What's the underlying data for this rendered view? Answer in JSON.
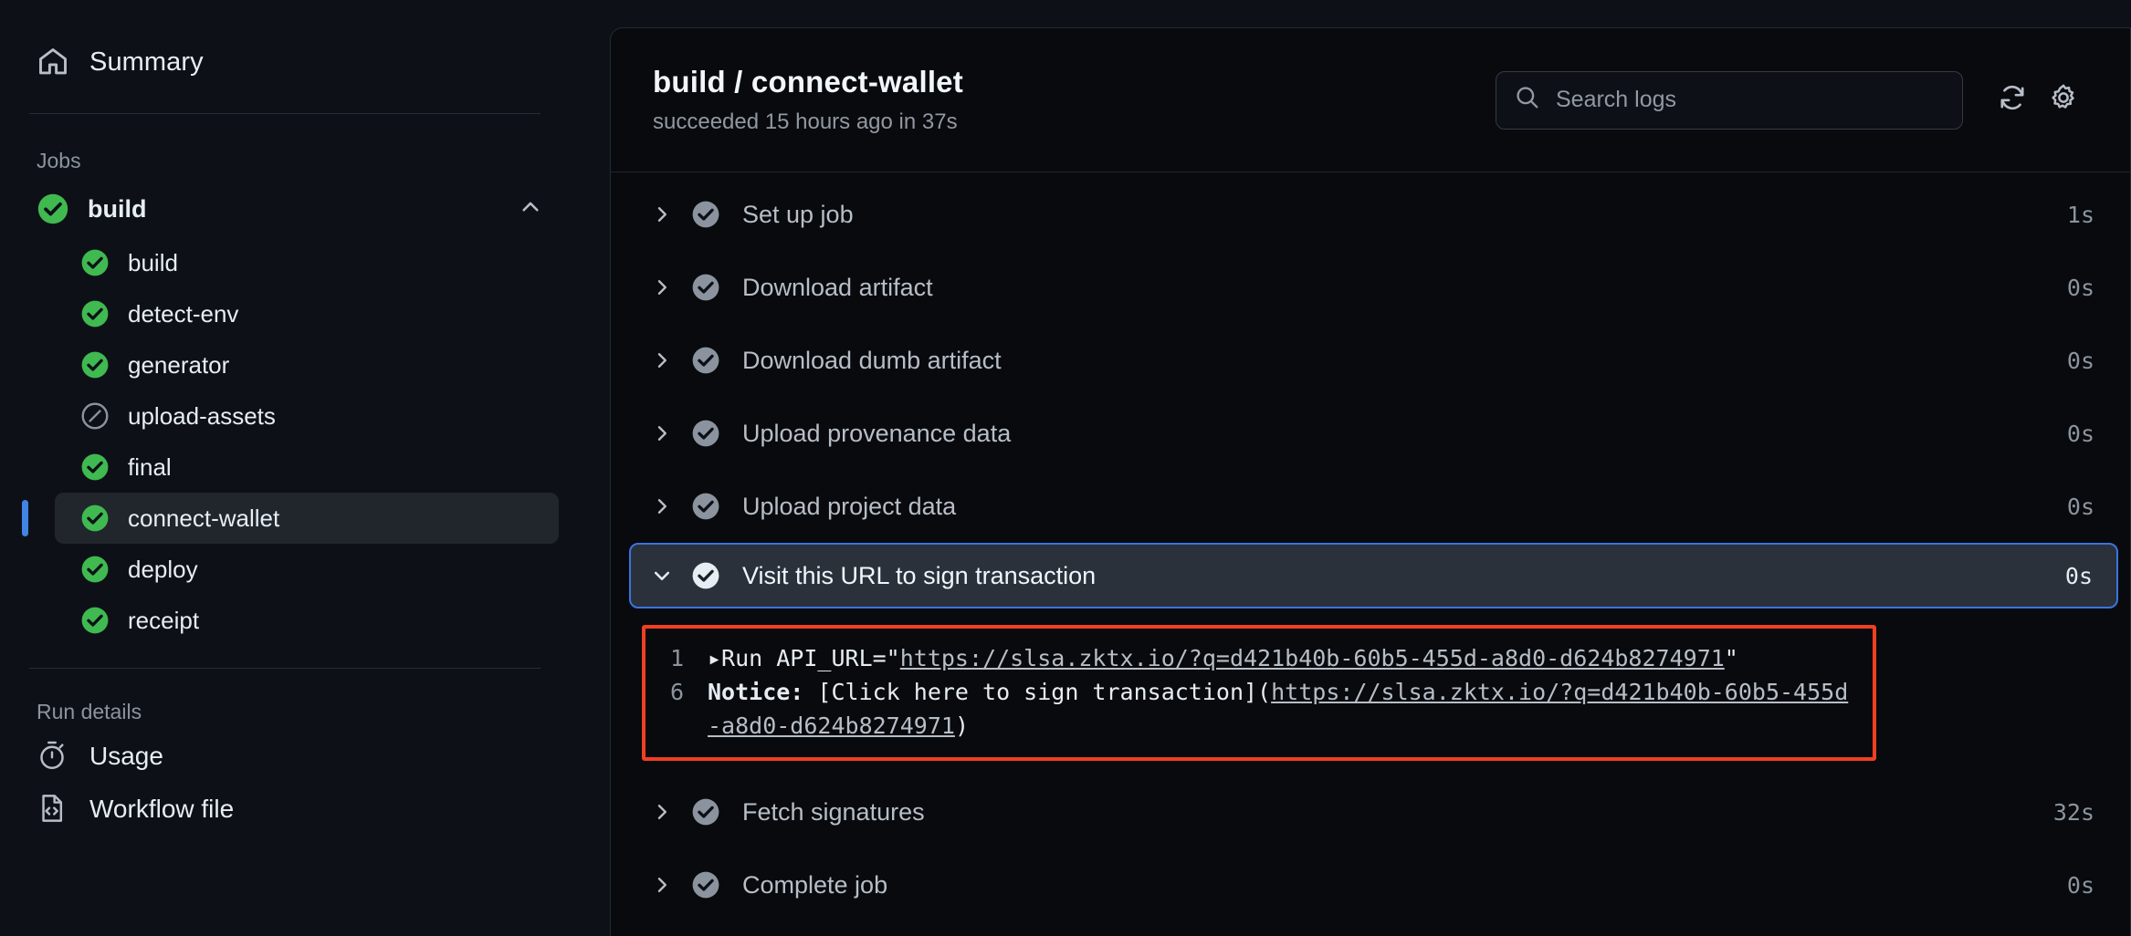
{
  "sidebar": {
    "summary": {
      "label": "Summary",
      "icon": "home-icon"
    },
    "jobs_label": "Jobs",
    "job": {
      "label": "build",
      "status": "success",
      "expanded": true
    },
    "steps": [
      {
        "label": "build",
        "status": "success"
      },
      {
        "label": "detect-env",
        "status": "success"
      },
      {
        "label": "generator",
        "status": "success"
      },
      {
        "label": "upload-assets",
        "status": "skipped"
      },
      {
        "label": "final",
        "status": "success"
      },
      {
        "label": "connect-wallet",
        "status": "success",
        "selected": true
      },
      {
        "label": "deploy",
        "status": "success"
      },
      {
        "label": "receipt",
        "status": "success"
      }
    ],
    "run_details_label": "Run details",
    "run_details": [
      {
        "label": "Usage",
        "icon": "stopwatch-icon"
      },
      {
        "label": "Workflow file",
        "icon": "workflow-file-icon"
      }
    ]
  },
  "header": {
    "title": "build / connect-wallet",
    "subtitle": "succeeded 15 hours ago in 37s",
    "search_placeholder": "Search logs",
    "search_value": "",
    "refresh_icon": "refresh-icon",
    "settings_icon": "gear-icon"
  },
  "log_steps": [
    {
      "title": "Set up job",
      "duration": "1s",
      "expanded": false,
      "status": "success"
    },
    {
      "title": "Download artifact",
      "duration": "0s",
      "expanded": false,
      "status": "success"
    },
    {
      "title": "Download dumb artifact",
      "duration": "0s",
      "expanded": false,
      "status": "success"
    },
    {
      "title": "Upload provenance data",
      "duration": "0s",
      "expanded": false,
      "status": "success"
    },
    {
      "title": "Upload project data",
      "duration": "0s",
      "expanded": false,
      "status": "success"
    },
    {
      "title": "Visit this URL to sign transaction",
      "duration": "0s",
      "expanded": true,
      "status": "success",
      "selected": true
    },
    {
      "title": "Fetch signatures",
      "duration": "32s",
      "expanded": false,
      "status": "success"
    },
    {
      "title": "Complete job",
      "duration": "0s",
      "expanded": false,
      "status": "success"
    }
  ],
  "log_output": {
    "url": "https://slsa.zktx.io/?q=d421b40b-60b5-455d-a8d0-d624b8274971",
    "lines": [
      {
        "number": "1",
        "prefix": "▸Run API_URL=\"",
        "link": "https://slsa.zktx.io/?q=d421b40b-60b5-455d-a8d0-d624b8274971",
        "suffix": "\""
      },
      {
        "number": "6",
        "bold_prefix": "Notice:",
        "prefix": " [Click here to sign transaction](",
        "link": "https://slsa.zktx.io/?q=d421b40b-60b5-455d-a8d0-d624b8274971",
        "suffix": ")"
      }
    ]
  },
  "colors": {
    "success": "#3fb950",
    "skipped": "#8b949e",
    "selection_border": "#3b74e0",
    "annotation_box": "#f04022",
    "page_bg": "#0d1117",
    "panel_bg": "#080a0e"
  }
}
